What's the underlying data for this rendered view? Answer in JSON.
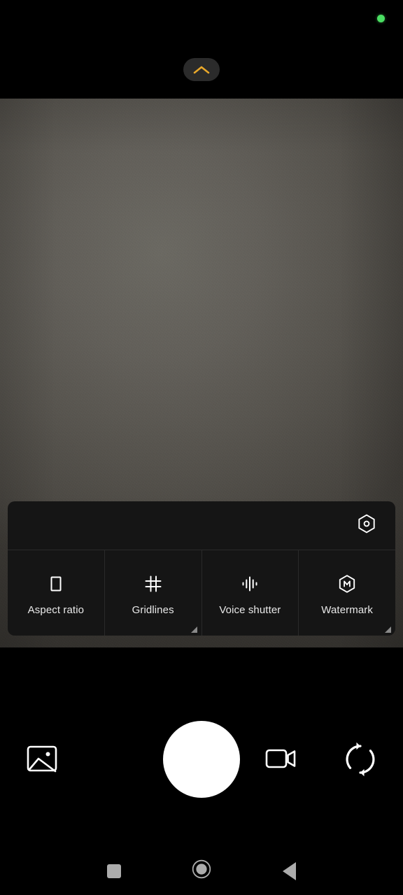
{
  "app": {
    "name": "Camera",
    "screen": "camera-viewfinder-with-settings-panel"
  },
  "colors": {
    "background": "#000000",
    "panel": "#151515",
    "panel_divider": "#2a2a2a",
    "accent_chevron": "#E9A82A",
    "privacy_dot": "#4ADE62",
    "icon_white": "#FFFFFF",
    "label_text": "#E9E9E9",
    "nav_icon": "#ACACAC",
    "shutter": "#FFFFFF",
    "pill_background": "#2B2B2B"
  },
  "top_bar": {
    "privacy_indicator": {
      "icon": "green-dot-icon",
      "label": "camera in use",
      "color": "#4ADE62"
    },
    "collapse_button": {
      "icon": "chevron-up-icon",
      "label": "Collapse settings",
      "color": "#E9A82A"
    }
  },
  "viewfinder": {
    "label": "Camera preview",
    "description": "grainy gray out-of-focus surface"
  },
  "settings_panel": {
    "more_settings": {
      "icon": "hexagon-settings-icon",
      "label": "More settings"
    },
    "tiles": [
      {
        "id": "aspect-ratio",
        "label": "Aspect ratio",
        "icon": "portrait-rectangle-icon",
        "expandable": false
      },
      {
        "id": "gridlines",
        "label": "Gridlines",
        "icon": "grid-hash-icon",
        "expandable": true
      },
      {
        "id": "voice-shutter",
        "label": "Voice shutter",
        "icon": "sound-wave-icon",
        "expandable": false
      },
      {
        "id": "watermark",
        "label": "Watermark",
        "icon": "hexagon-m-icon",
        "expandable": true
      }
    ]
  },
  "bottom_controls": {
    "gallery": {
      "icon": "image-gallery-icon",
      "label": "Gallery"
    },
    "shutter": {
      "icon": "shutter-circle-icon",
      "label": "Take photo"
    },
    "video": {
      "icon": "video-camera-icon",
      "label": "Video mode"
    },
    "flip": {
      "icon": "camera-flip-icon",
      "label": "Switch camera"
    }
  },
  "nav_bar": {
    "recents": {
      "icon": "square-recents-icon",
      "label": "Recents"
    },
    "home": {
      "icon": "circle-home-icon",
      "label": "Home"
    },
    "back": {
      "icon": "triangle-back-icon",
      "label": "Back"
    }
  }
}
